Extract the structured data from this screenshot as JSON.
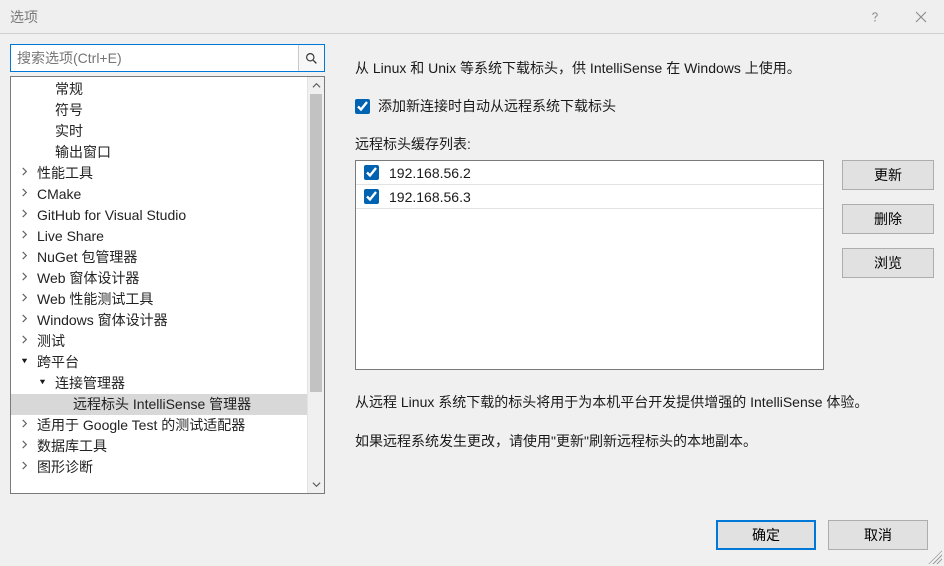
{
  "window": {
    "title": "选项"
  },
  "search": {
    "placeholder": "搜索选项(Ctrl+E)"
  },
  "tree": {
    "items": [
      {
        "label": "常规",
        "indent": 1,
        "caret": "",
        "interact": true
      },
      {
        "label": "符号",
        "indent": 1,
        "caret": "",
        "interact": true
      },
      {
        "label": "实时",
        "indent": 1,
        "caret": "",
        "interact": true
      },
      {
        "label": "输出窗口",
        "indent": 1,
        "caret": "",
        "interact": true
      },
      {
        "label": "性能工具",
        "indent": 0,
        "caret": "closed",
        "interact": true
      },
      {
        "label": "CMake",
        "indent": 0,
        "caret": "closed",
        "interact": true
      },
      {
        "label": "GitHub for Visual Studio",
        "indent": 0,
        "caret": "closed",
        "interact": true
      },
      {
        "label": "Live Share",
        "indent": 0,
        "caret": "closed",
        "interact": true
      },
      {
        "label": "NuGet 包管理器",
        "indent": 0,
        "caret": "closed",
        "interact": true
      },
      {
        "label": "Web 窗体设计器",
        "indent": 0,
        "caret": "closed",
        "interact": true
      },
      {
        "label": "Web 性能测试工具",
        "indent": 0,
        "caret": "closed",
        "interact": true
      },
      {
        "label": "Windows 窗体设计器",
        "indent": 0,
        "caret": "closed",
        "interact": true
      },
      {
        "label": "测试",
        "indent": 0,
        "caret": "closed",
        "interact": true
      },
      {
        "label": "跨平台",
        "indent": 0,
        "caret": "open",
        "interact": true
      },
      {
        "label": "连接管理器",
        "indent": 1,
        "caret": "open",
        "interact": true
      },
      {
        "label": "远程标头 IntelliSense 管理器",
        "indent": 2,
        "caret": "",
        "interact": true,
        "selected": true
      },
      {
        "label": "适用于 Google Test 的测试适配器",
        "indent": 0,
        "caret": "closed",
        "interact": true
      },
      {
        "label": "数据库工具",
        "indent": 0,
        "caret": "closed",
        "interact": true
      },
      {
        "label": "图形诊断",
        "indent": 0,
        "caret": "closed",
        "interact": true
      }
    ]
  },
  "panel": {
    "description": "从 Linux 和 Unix 等系统下载标头，供 IntelliSense 在 Windows 上使用。",
    "auto_download_label": "添加新连接时自动从远程系统下载标头",
    "auto_download_checked": true,
    "list_label": "远程标头缓存列表:",
    "list": [
      {
        "label": "192.168.56.2",
        "checked": true
      },
      {
        "label": "192.168.56.3",
        "checked": true
      }
    ],
    "buttons": {
      "update": "更新",
      "delete": "删除",
      "browse": "浏览"
    },
    "note1": "从远程 Linux 系统下载的标头将用于为本机平台开发提供增强的 IntelliSense 体验。",
    "note2": "如果远程系统发生更改，请使用\"更新\"刷新远程标头的本地副本。"
  },
  "dialog_buttons": {
    "ok": "确定",
    "cancel": "取消"
  }
}
